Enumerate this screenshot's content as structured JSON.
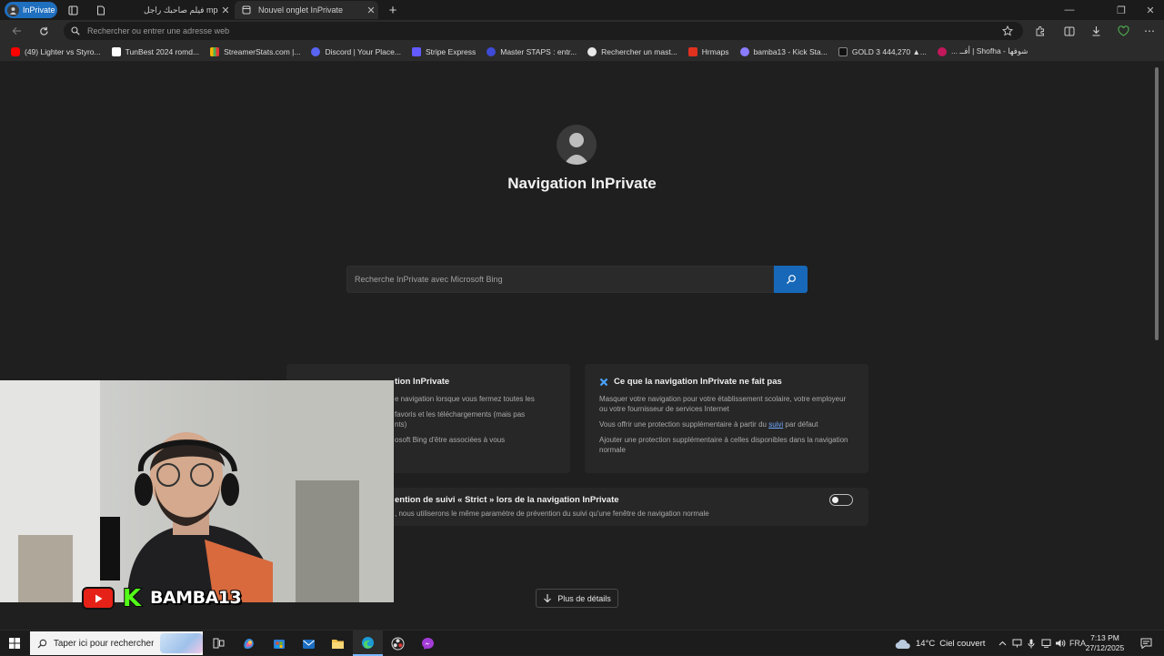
{
  "browser": {
    "profile_label": "InPrivate",
    "tabs": [
      {
        "title": "فيلم صاحبك راجل mp4.2",
        "active": false
      },
      {
        "title": "Nouvel onglet InPrivate",
        "active": true
      }
    ],
    "new_tab_symbol": "+",
    "address_placeholder": "Rechercher ou entrer une adresse web"
  },
  "bookmarks": [
    {
      "label": "(49) Lighter vs Styro...",
      "color": "#ff0000"
    },
    {
      "label": "TunBest 2024 romd...",
      "color": "#ffffff"
    },
    {
      "label": "StreamerStats.com |...",
      "color": "#f5b400"
    },
    {
      "label": "Discord | Your Place...",
      "color": "#5865f2"
    },
    {
      "label": "Stripe Express",
      "color": "#635bff"
    },
    {
      "label": "Master STAPS : entr...",
      "color": "#3d4bd6"
    },
    {
      "label": "Rechercher un mast...",
      "color": "#e8e8e8"
    },
    {
      "label": "Hrmaps",
      "color": "#e0321f"
    },
    {
      "label": "bamba13 - Kick Sta...",
      "color": "#8a7cff"
    },
    {
      "label": "GOLD 3 444,270 ▲...",
      "color": "#111111"
    },
    {
      "label": "... أفــ | Shofha - شوفها",
      "color": "#c2185b"
    }
  ],
  "page": {
    "title": "Navigation InPrivate",
    "search_placeholder": "Recherche InPrivate avec Microsoft Bing",
    "card_left": {
      "title": "tion InPrivate",
      "lines": [
        "e navigation lorsque vous fermez toutes les",
        "favoris et les téléchargements (mais pas",
        "nts)",
        "osoft Bing d'être associées à vous"
      ]
    },
    "card_right": {
      "title": "Ce que la navigation InPrivate ne fait pas",
      "lines": [
        "Masquer votre navigation pour votre établissement scolaire, votre employeur ou votre fournisseur de services Internet",
        "Ajouter une protection supplémentaire à celles disponibles dans la navigation normale"
      ],
      "line2_before": "Vous offrir une protection supplémentaire à partir du ",
      "line2_link": "suivi",
      "line2_after": " par défaut"
    },
    "tracking": {
      "title": "ention de suivi « Strict » lors de la navigation InPrivate",
      "description": ", nous utiliserons le même paramètre de prévention du suivi qu'une fenêtre de navigation normale",
      "toggle_on": false
    },
    "details_button": "Plus de détails"
  },
  "overlay": {
    "streamer_name": "BAMBA13",
    "kick_letter": "K"
  },
  "taskbar": {
    "search_placeholder": "Taper ici pour rechercher",
    "weather_temp": "14°C",
    "weather_desc": "Ciel couvert",
    "language": "FRA",
    "time": "7:13 PM",
    "date": "27/12/2025"
  }
}
